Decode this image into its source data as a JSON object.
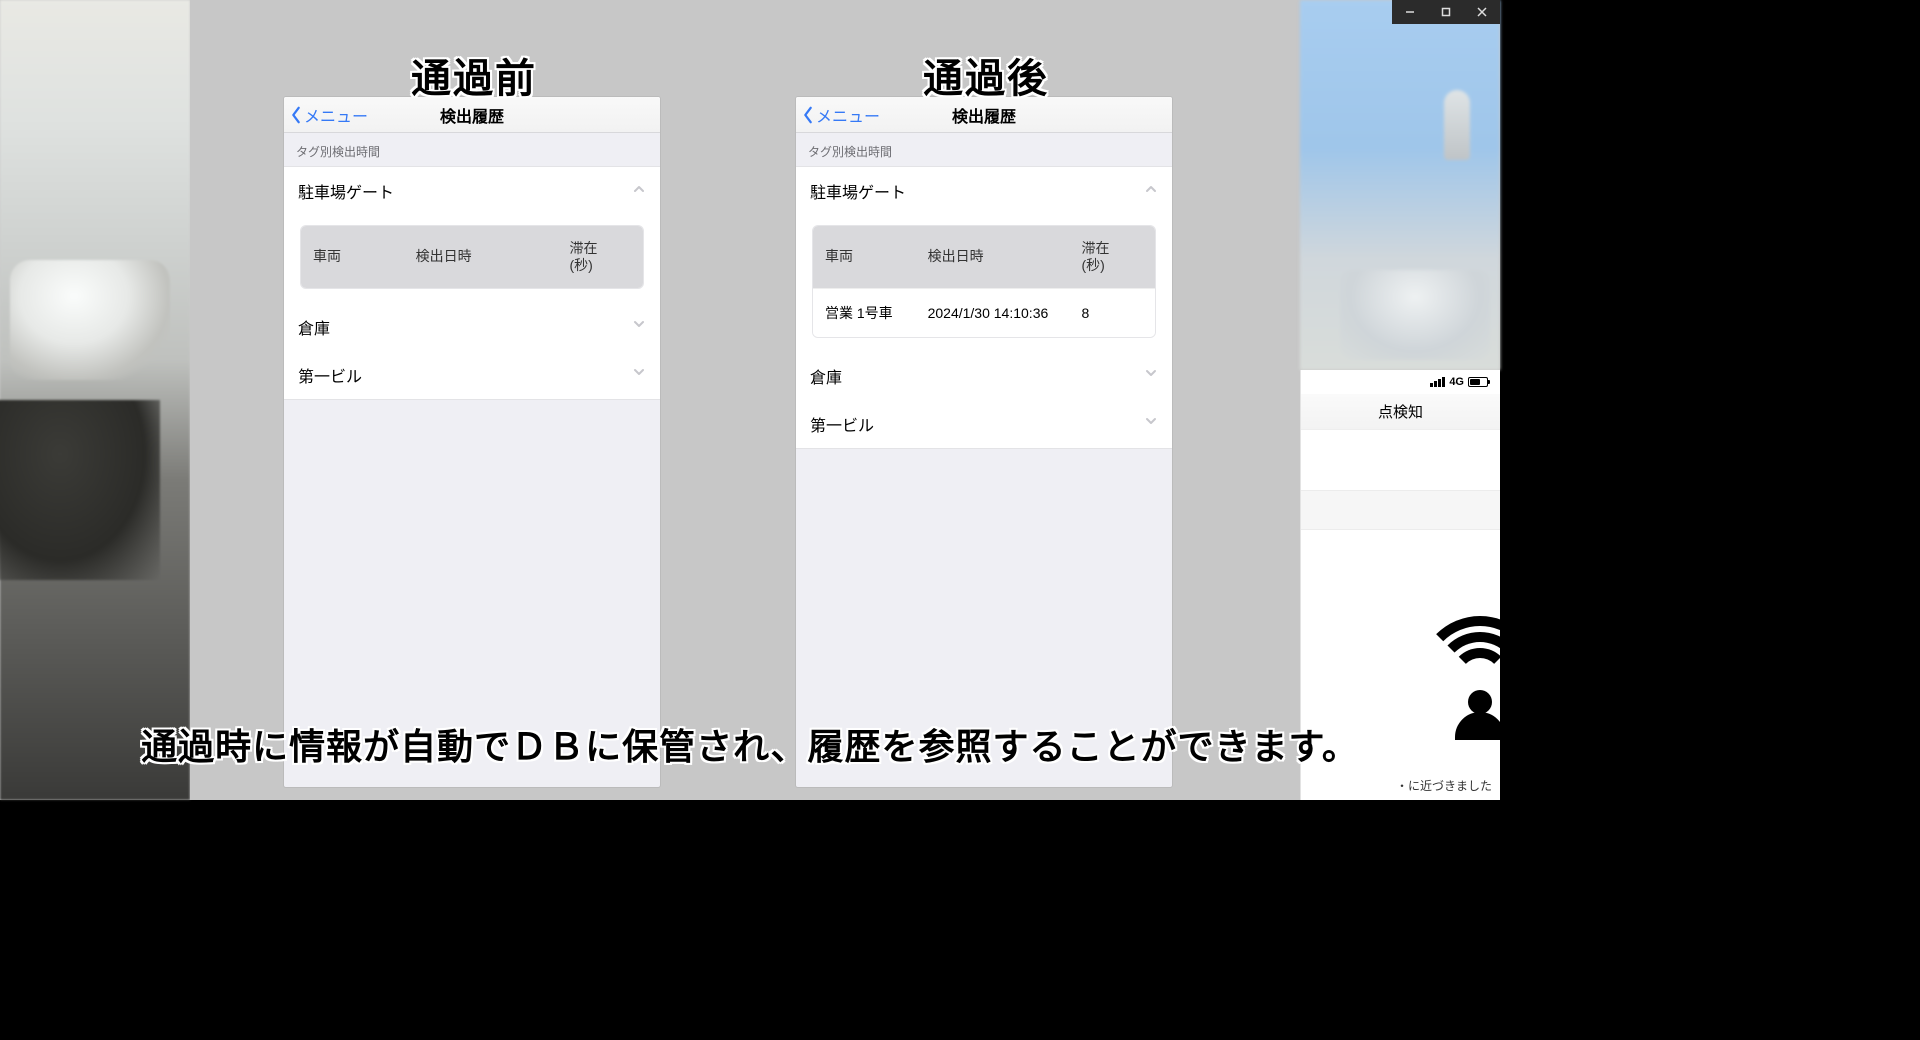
{
  "window": {
    "minimize": "–",
    "maximize": "□",
    "close": "×"
  },
  "labels": {
    "before": "通過前",
    "after": "通過後"
  },
  "nav": {
    "back": "メニュー",
    "title": "検出履歴"
  },
  "section_header": "タグ別検出時間",
  "table_headers": {
    "vehicle": "車両",
    "detected_at": "検出日時",
    "stay_sec": "滞在\n(秒)"
  },
  "panel_before": {
    "accordion": [
      {
        "label": "駐車場ゲート",
        "expanded": true,
        "rows": []
      },
      {
        "label": "倉庫",
        "expanded": false,
        "rows": []
      },
      {
        "label": "第一ビル",
        "expanded": false,
        "rows": []
      }
    ]
  },
  "panel_after": {
    "accordion": [
      {
        "label": "駐車場ゲート",
        "expanded": true,
        "rows": [
          {
            "vehicle": "営業 1号車",
            "detected_at": "2024/1/30 14:10:36",
            "stay_sec": "8"
          }
        ]
      },
      {
        "label": "倉庫",
        "expanded": false,
        "rows": []
      },
      {
        "label": "第一ビル",
        "expanded": false,
        "rows": []
      }
    ]
  },
  "right_phone": {
    "network": "4G",
    "nav_title": "点検知",
    "toast_suffix": "・に近づきました"
  },
  "caption": "通過時に情報が自動でＤＢに保管され、履歴を参照することができます。"
}
